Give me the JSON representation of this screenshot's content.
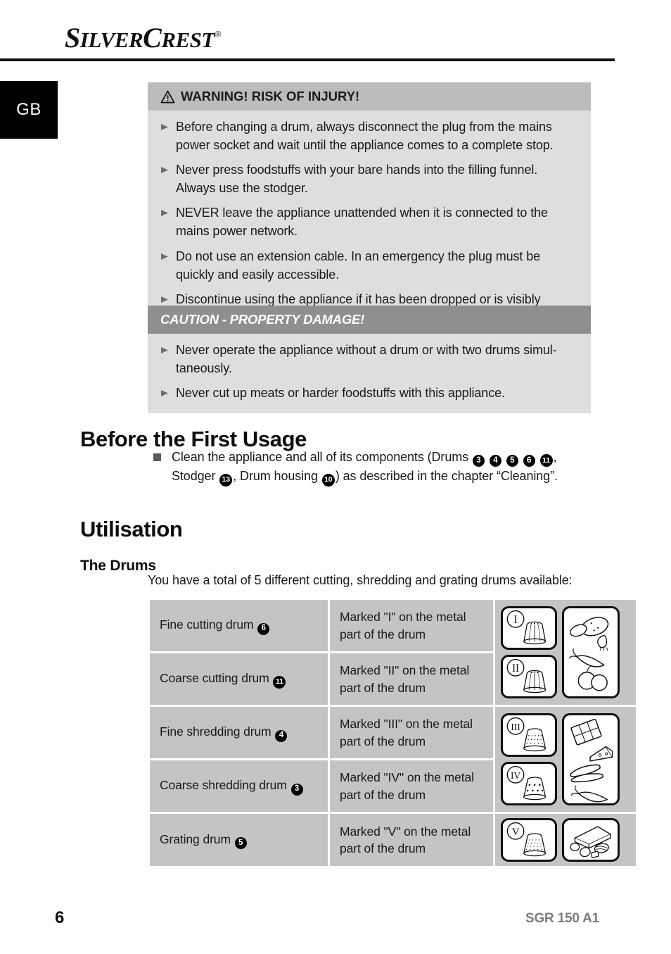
{
  "brand": {
    "name_cap_1": "S",
    "name_small_1": "ILVER",
    "name_cap_2": "C",
    "name_small_2": "REST",
    "registered": "®"
  },
  "language_tab": {
    "label": "GB"
  },
  "warning_box": {
    "icon": "warning-triangle-icon",
    "title": "WARNING! RISK OF INJURY!",
    "header_bg": "#bcbcbc",
    "body_bg": "#dedede",
    "items": [
      "Before changing a drum, always disconnect the plug from the mains power socket and wait until the appliance comes to a complete stop.",
      "Never press foodstuffs with your bare hands into the filling funnel. Always use the stodger.",
      "NEVER leave the appliance unattended when it is connected to the mains power network.",
      "Do not use an extension cable. In an emergency the plug must be quickly and easily accessible.",
      "Discontinue using the appliance if it has been dropped or is visibly damaged."
    ]
  },
  "caution_box": {
    "title": "CAUTION - PROPERTY DAMAGE!",
    "header_bg": "#8f8f8f",
    "header_color": "#ffffff",
    "body_bg": "#dedede",
    "items": [
      "Never operate the appliance without a drum or with two drums simul-taneously.",
      "Never cut up meats or harder foodstuffs with this appliance."
    ]
  },
  "sections": {
    "before_first_usage": {
      "heading": "Before the First Usage",
      "bullet_prefix": "Clean the appliance and all of its components (Drums ",
      "drum_numbers": [
        "3",
        "4",
        "5",
        "6",
        "11"
      ],
      "bullet_mid": ", Stodger ",
      "stodger_number": "13",
      "bullet_mid_2": ", Drum housing ",
      "housing_number": "10",
      "bullet_suffix": ") as described in the chapter “Cleaning”."
    },
    "utilisation": {
      "heading": "Utilisation",
      "subheading": "The Drums",
      "intro": "You have a total of 5 different cutting, shredding and grating drums available:"
    }
  },
  "drums_table": {
    "rows": [
      {
        "name": "Fine cutting drum ",
        "number": "6",
        "marking": "Marked \"I\" on the metal part of the drum",
        "roman": "I",
        "drum_icon": "fine-cutting-drum-icon"
      },
      {
        "name": "Coarse cutting drum ",
        "number": "11",
        "marking": "Marked \"II\" on the metal part of the drum",
        "roman": "II",
        "drum_icon": "coarse-cutting-drum-icon"
      },
      {
        "name": "Fine shredding drum ",
        "number": "4",
        "marking": "Marked \"III\" on the metal part of the drum",
        "roman": "III",
        "drum_icon": "fine-shredding-drum-icon"
      },
      {
        "name": "Coarse shredding drum ",
        "number": "3",
        "marking": "Marked \"IV\" on the metal part of the drum",
        "roman": "IV",
        "drum_icon": "coarse-shredding-drum-icon"
      },
      {
        "name": "Grating drum ",
        "number": "5",
        "marking": "Marked \"V\" on the metal part of the drum",
        "roman": "V",
        "drum_icon": "grating-drum-icon"
      }
    ],
    "food_groups": [
      "potato-onion-carrot-apple-illustration",
      "chocolate-cheese-cucumber-carrot-illustration",
      "cheese-nuts-illustration"
    ]
  },
  "footer": {
    "page_number": "6",
    "model": "SGR 150 A1"
  }
}
